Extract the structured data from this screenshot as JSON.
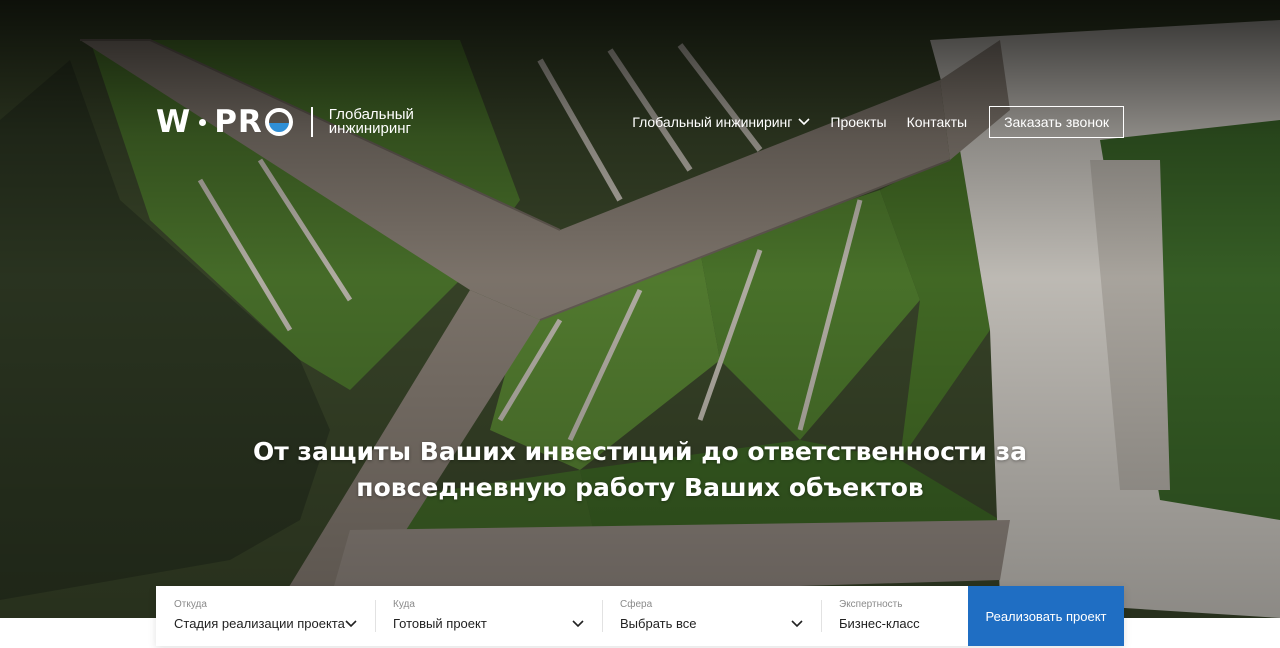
{
  "brand": {
    "logo_text": "W·PRO",
    "tagline": "Глобальный инжиниринг"
  },
  "nav": {
    "items": [
      {
        "label": "Глобальный инжиниринг",
        "icon": "chevron-down-icon"
      },
      {
        "label": "Проекты"
      },
      {
        "label": "Контакты"
      }
    ],
    "cta_label": "Заказать звонок"
  },
  "hero": {
    "headline_line1": "От защиты Ваших инвестиций до ответственности за",
    "headline_line2": "повседневную работу Ваших объектов"
  },
  "search": {
    "fields": [
      {
        "label": "Откуда",
        "value": "Стадия реализации проекта",
        "icon": "chevron-down-icon"
      },
      {
        "label": "Куда",
        "value": "Готовый проект",
        "icon": "chevron-down-icon"
      },
      {
        "label": "Сфера",
        "value": "Выбрать все",
        "icon": "chevron-down-icon"
      },
      {
        "label": "Экспертность",
        "value": "Бизнес-класс"
      }
    ],
    "submit_label": "Реализовать проект"
  },
  "colors": {
    "accent": "#1f6ec3",
    "logo_blue": "#2f8fd6"
  }
}
